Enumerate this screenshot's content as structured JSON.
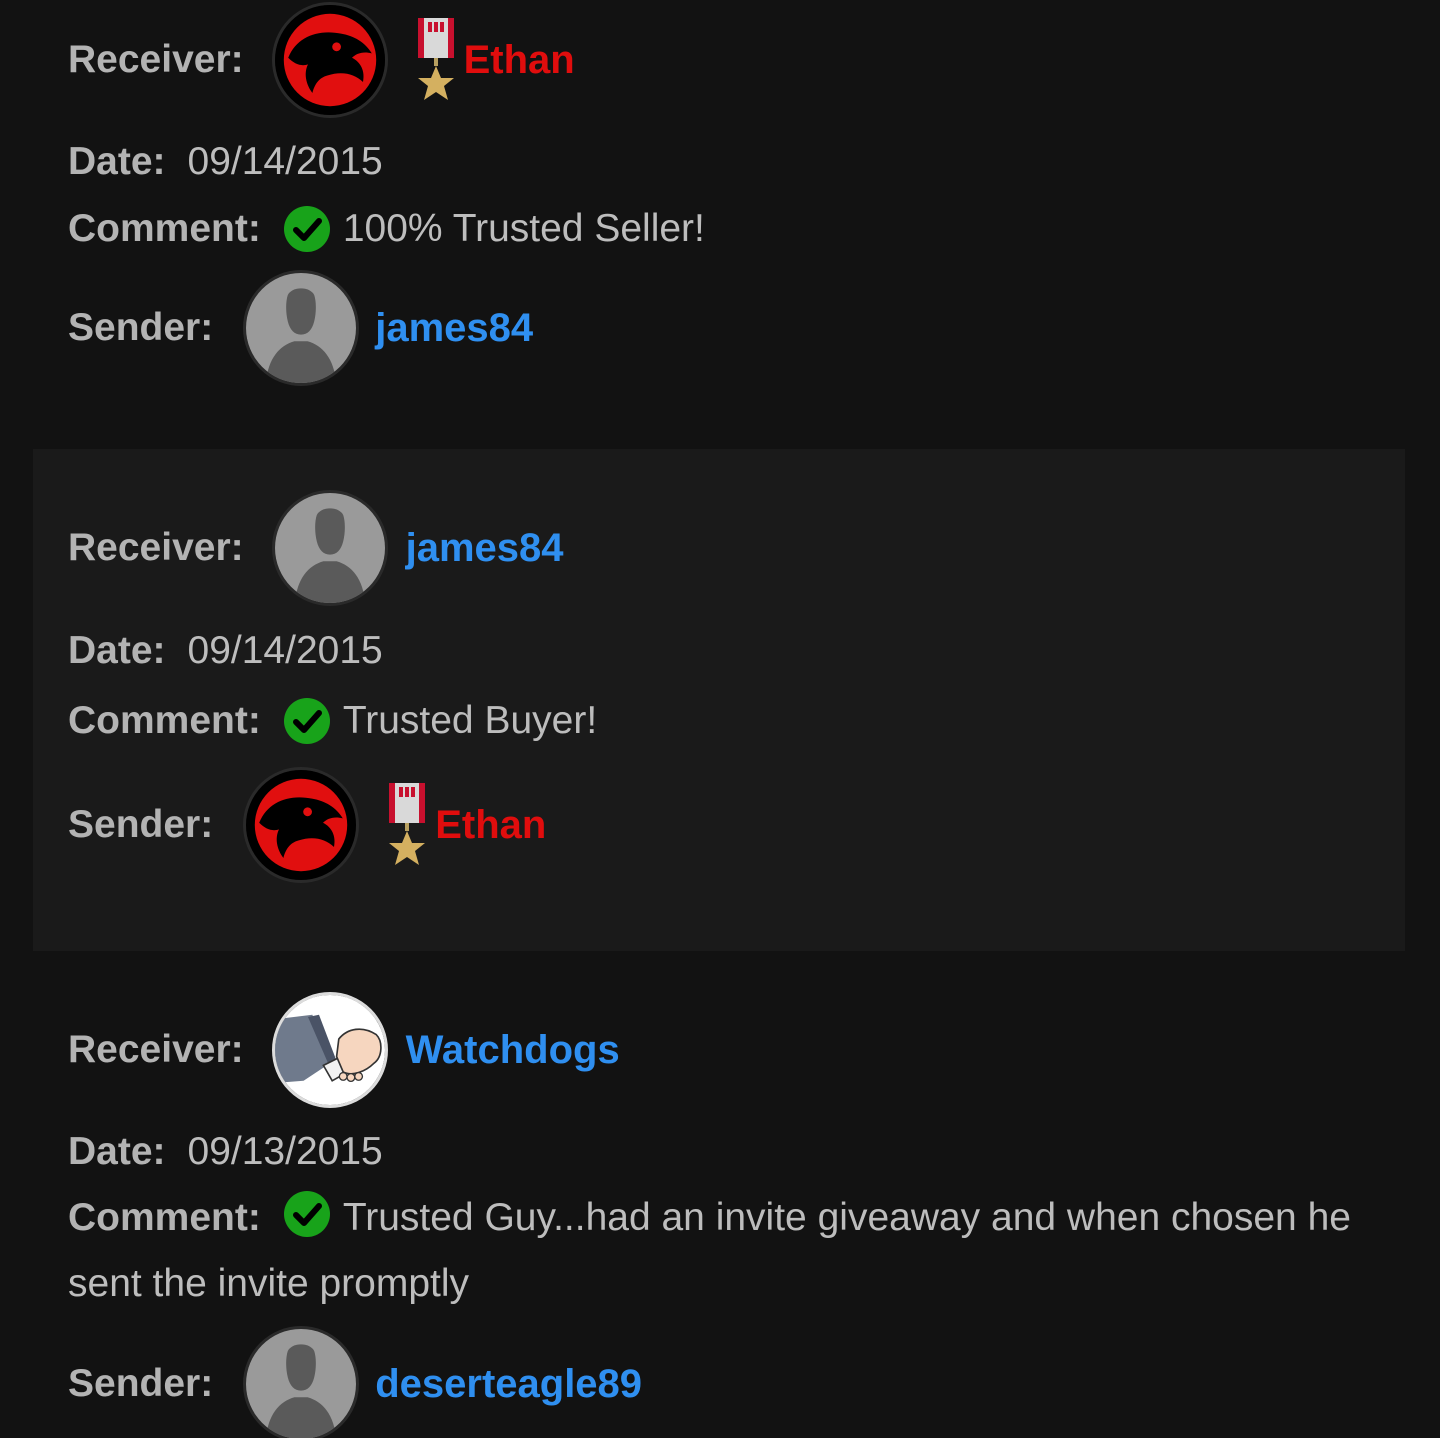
{
  "labels": {
    "receiver": "Receiver:",
    "date": "Date:",
    "comment": "Comment:",
    "sender": "Sender:"
  },
  "colors": {
    "background": "#121212",
    "alt_background": "#1a1a1a",
    "label": "#b3b3b3",
    "value": "#bdbdbd",
    "admin_name": "#e00d0d",
    "member_name": "#2f8ff0",
    "check_green": "#18a31a"
  },
  "entries": [
    {
      "receiver": {
        "name": "Ethan",
        "avatar": "red-panther-logo-avatar",
        "badge": "medal-icon",
        "name_color": "#e00d0d"
      },
      "date": "09/14/2015",
      "comment": "100% Trusted Seller!",
      "sender": {
        "name": "james84",
        "avatar": "default-silhouette-avatar",
        "name_color": "#2f8ff0"
      }
    },
    {
      "receiver": {
        "name": "james84",
        "avatar": "default-silhouette-avatar",
        "name_color": "#2f8ff0"
      },
      "date": "09/14/2015",
      "comment": "Trusted Buyer!",
      "sender": {
        "name": "Ethan",
        "avatar": "red-panther-logo-avatar",
        "badge": "medal-icon",
        "name_color": "#e00d0d"
      }
    },
    {
      "receiver": {
        "name": "Watchdogs",
        "avatar": "handshake-avatar",
        "name_color": "#2f8ff0"
      },
      "date": "09/13/2015",
      "comment": "Trusted Guy...had an invite giveaway and when chosen he sent the invite promptly",
      "sender": {
        "name": "deserteagle89",
        "avatar": "default-silhouette-avatar",
        "name_color": "#2f8ff0"
      }
    }
  ]
}
